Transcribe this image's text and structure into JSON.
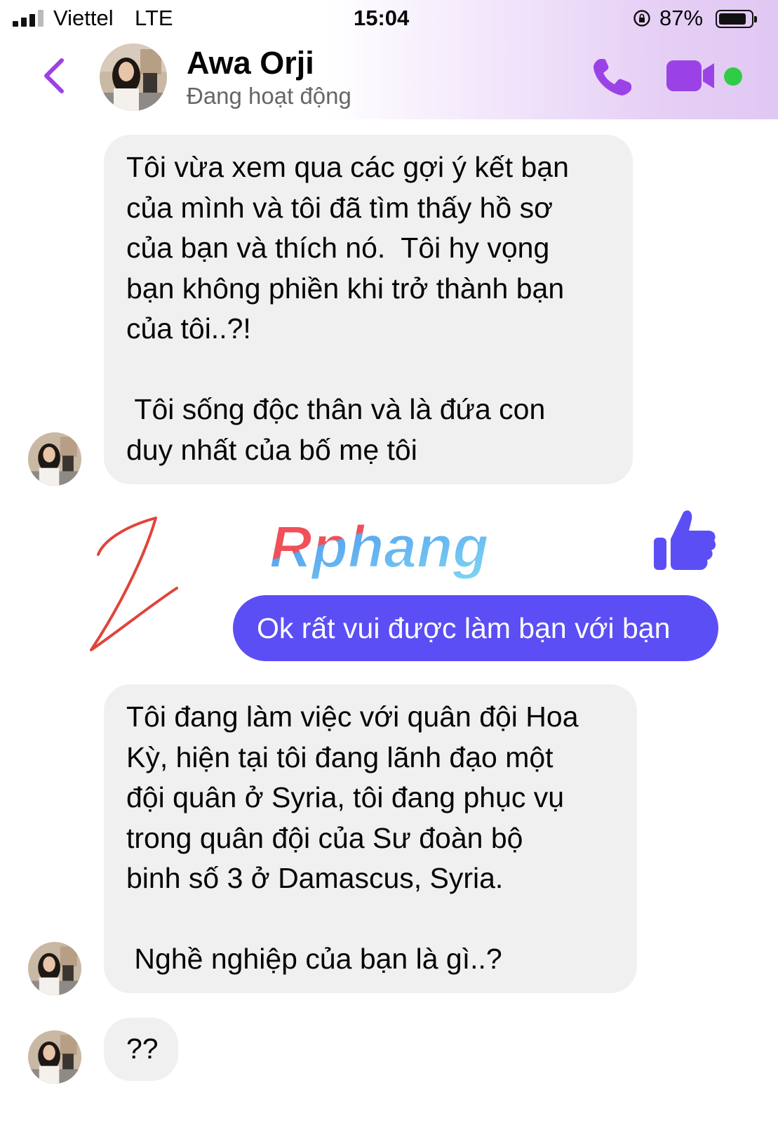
{
  "status_bar": {
    "carrier": "Viettel",
    "network": "LTE",
    "time": "15:04",
    "battery_percent": "87%",
    "battery_level": 0.87,
    "icons": [
      "signal-icon",
      "orientation-lock-icon",
      "battery-icon"
    ]
  },
  "header": {
    "back_icon": "chevron-left-icon",
    "contact_name": "Awa Orji",
    "contact_status": "Đang hoạt động",
    "call_icon": "phone-icon",
    "video_icon": "video-camera-icon",
    "online_indicator": "online-dot",
    "accent_color": "#9b42e6"
  },
  "messages": [
    {
      "sender": "contact",
      "text": "Tôi vừa xem qua các gợi ý kết bạn\ncủa mình và tôi đã tìm thấy hồ sơ\ncủa bạn và thích nó.  Tôi hy vọng\nbạn không phiền khi trở thành bạn\ncủa tôi..?!\n\n Tôi sống độc thân và là đứa con\nduy nhất của bố mẹ tôi"
    },
    {
      "sender": "me",
      "text": "Ok rất vui được làm bạn với bạn"
    },
    {
      "sender": "contact",
      "text": "Tôi đang làm việc với quân đội Hoa\nKỳ, hiện tại tôi đang lãnh đạo một\nđội quân ở Syria, tôi đang phục vụ\ntrong quân đội của Sư đoàn bộ\nbinh số 3 ở Damascus, Syria.\n\n Nghề nghiệp của bạn là gì..?"
    },
    {
      "sender": "contact",
      "text": "??"
    }
  ],
  "overlays": {
    "watermark_text": "Rphang",
    "like_icon": "thumbs-up-icon",
    "annotation": "red-scribble"
  },
  "colors": {
    "sent_bubble": "#5b4ef5",
    "received_bubble": "#f0f0f0",
    "like": "#5b4ef5",
    "online": "#31cc46",
    "scribble": "#e0443a"
  }
}
